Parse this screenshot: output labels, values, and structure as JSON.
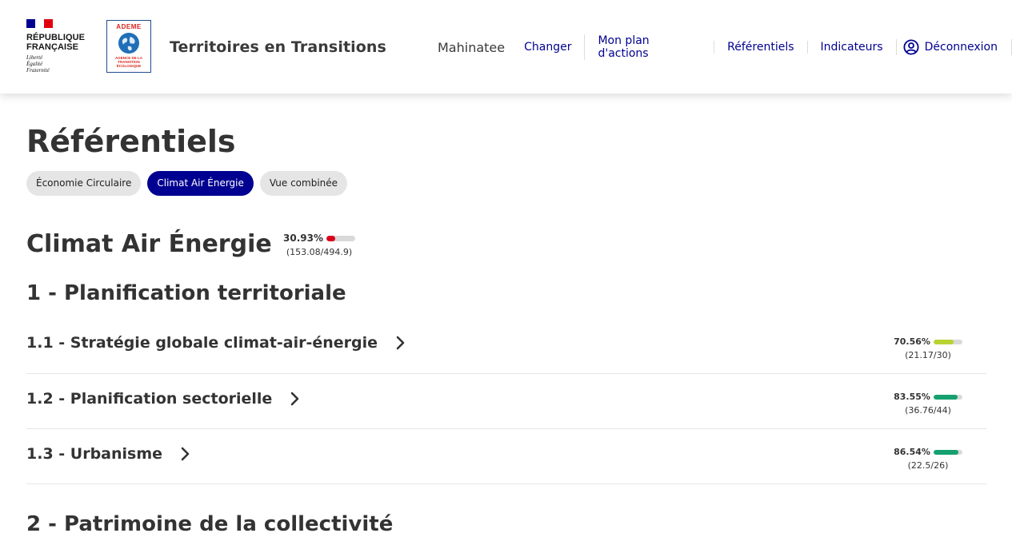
{
  "colors": {
    "primary": "#000091",
    "flag_blue": "#000091",
    "flag_white": "#ffffff",
    "flag_red": "#e1000f",
    "score_low": "#d9001b",
    "score_mid": "#b8d432",
    "score_high": "#14a06f",
    "bar_track": "#d9d9d9"
  },
  "header": {
    "gov_logo": {
      "line1": "RÉPUBLIQUE",
      "line2": "FRANÇAISE",
      "motto1": "Liberté",
      "motto2": "Égalité",
      "motto3": "Fraternité"
    },
    "ademe_logo": {
      "name": "ADEME",
      "subtitle": "AGENCE DE LA\nTRANSITION\nÉCOLOGIQUE"
    },
    "site_title": "Territoires en Transitions",
    "nav": {
      "user": "Mahinatee",
      "change": "Changer",
      "action_plan": "Mon plan d'actions",
      "referentials": "Référentiels",
      "indicators": "Indicateurs",
      "logout": "Déconnexion",
      "logout_icon": "user-circle-icon"
    }
  },
  "main": {
    "page_title": "Référentiels",
    "tabs": [
      {
        "label": "Économie Circulaire",
        "active": false
      },
      {
        "label": "Climat Air Énergie",
        "active": true
      },
      {
        "label": "Vue combinée",
        "active": false
      }
    ],
    "referential": {
      "title": "Climat Air Énergie",
      "score": {
        "percent_label": "30.93%",
        "fraction_label": "(153.08/494.9)",
        "ratio": 0.3093
      }
    },
    "sections": [
      {
        "title": "1 - Planification territoriale",
        "subsections": [
          {
            "title": "1.1 - Stratégie globale climat-air-énergie",
            "percent_label": "70.56%",
            "fraction_label": "(21.17/30)",
            "ratio": 0.7056
          },
          {
            "title": "1.2 - Planification sectorielle",
            "percent_label": "83.55%",
            "fraction_label": "(36.76/44)",
            "ratio": 0.8355
          },
          {
            "title": "1.3 - Urbanisme",
            "percent_label": "86.54%",
            "fraction_label": "(22.5/26)",
            "ratio": 0.8654
          }
        ]
      },
      {
        "title": "2 - Patrimoine de la collectivité",
        "subsections": []
      }
    ]
  }
}
